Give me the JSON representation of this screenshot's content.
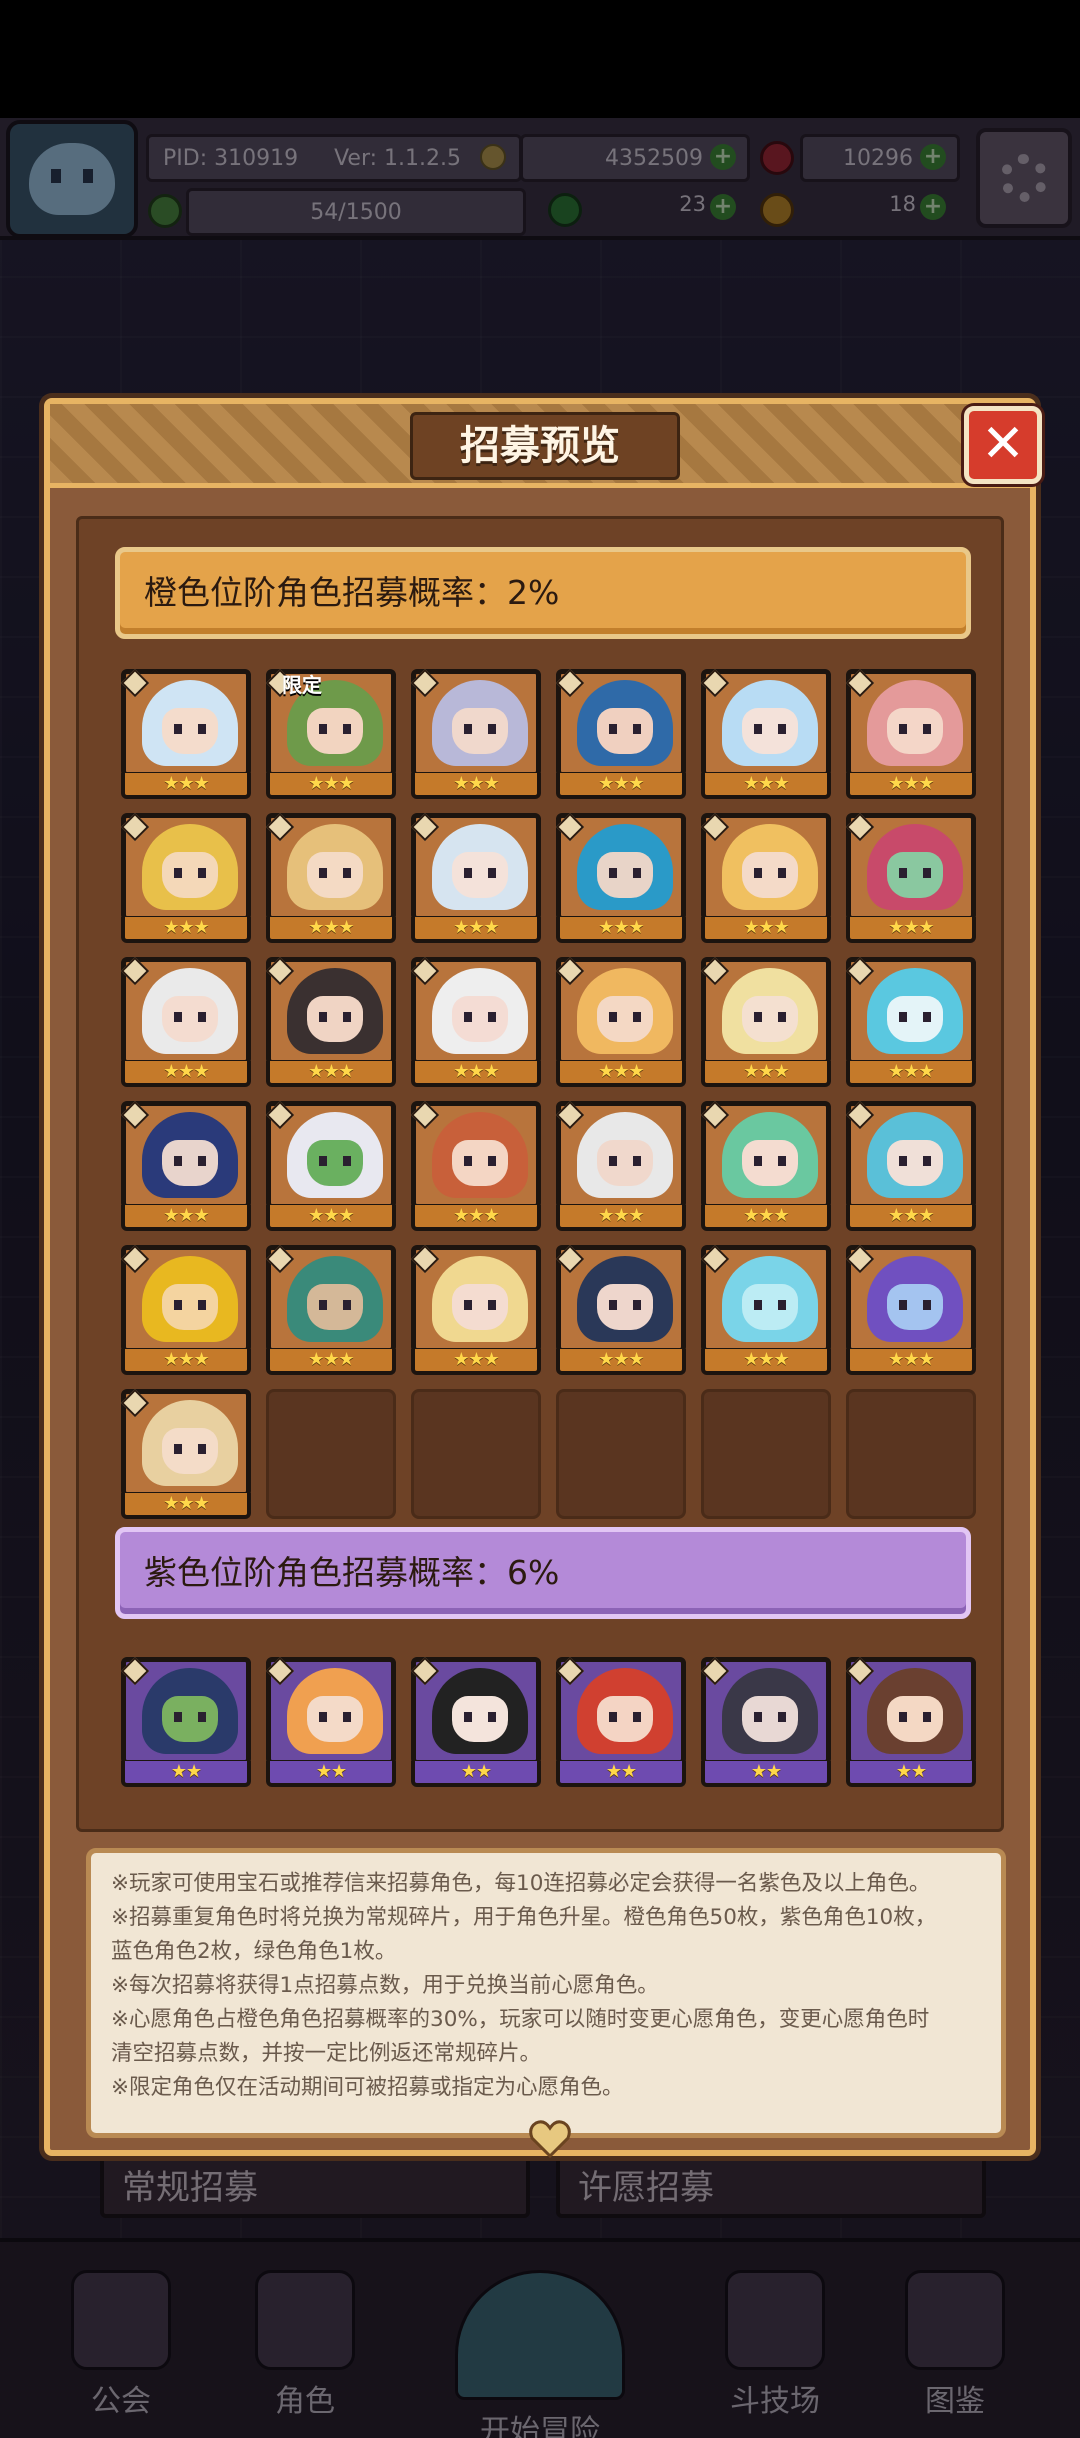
{
  "hud": {
    "pid": "PID: 310919",
    "ver": "Ver: 1.1.2.5",
    "gold": "4352509",
    "gems": "10296",
    "stamina": "54/1500",
    "clover": "23",
    "tickets": "18"
  },
  "modal": {
    "title": "招募预览",
    "close": "✕"
  },
  "orange_banner": "橙色位阶角色招募概率：2%",
  "purple_banner": "紫色位阶角色招募概率：6%",
  "limited_badge": "限定",
  "stars3": "★★★",
  "stars2": "★★",
  "notes": [
    "※玩家可使用宝石或推荐信来招募角色，每10连招募必定会获得一名紫色及以上角色。",
    "※招募重复角色时将兑换为常规碎片，用于角色升星。橙色角色50枚，紫色角色10枚，",
    "蓝色角色2枚，绿色角色1枚。",
    "※每次招募将获得1点招募点数，用于兑换当前心愿角色。",
    "※心愿角色占橙色角色招募概率的30%，玩家可以随时变更心愿角色，变更心愿角色时",
    "清空招募点数，并按一定比例返还常规碎片。",
    "※限定角色仅在活动期间可被招募或指定为心愿角色。"
  ],
  "behind": {
    "left": "常规招募",
    "right": "许愿招募"
  },
  "nav": {
    "guild": "公会",
    "characters": "角色",
    "adventure": "开始冒险",
    "arena": "斗技场",
    "codex": "图鉴"
  },
  "colors": {
    "orange": "#e4a34a",
    "purple": "#b48ad8",
    "frame": "#e7b463"
  }
}
